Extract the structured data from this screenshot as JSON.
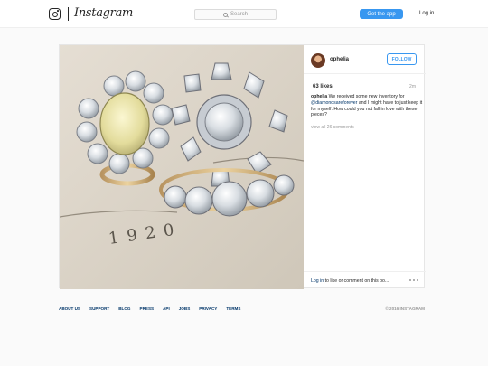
{
  "header": {
    "logo_word": "Instagram",
    "search_placeholder": "Search",
    "get_app_label": "Get the app",
    "login_label": "Log in"
  },
  "post": {
    "username": "ophelia",
    "follow_label": "FOLLOW",
    "likes": "63 likes",
    "time_ago": "2m",
    "caption_user": "ophelia",
    "caption_part1": " We received some new inventory for ",
    "caption_mention": "@diamondsareforever",
    "caption_part2": " and I might have to just keep it for myself. How could you not fall in love with these pieces?",
    "view_comments": "view all 26 comments",
    "login_link": "Log in",
    "comment_prompt": " to like or comment on this po...",
    "photo_text_year": "1920"
  },
  "footer": {
    "links": [
      "ABOUT US",
      "SUPPORT",
      "BLOG",
      "PRESS",
      "API",
      "JOBS",
      "PRIVACY",
      "TERMS"
    ],
    "copyright": "© 2016 INSTAGRAM"
  },
  "colors": {
    "accent": "#3897f0",
    "link": "#003569",
    "muted": "#999999"
  },
  "icons": {
    "logo": "instagram-camera-icon",
    "search": "search-icon",
    "more": "more-options-icon"
  }
}
